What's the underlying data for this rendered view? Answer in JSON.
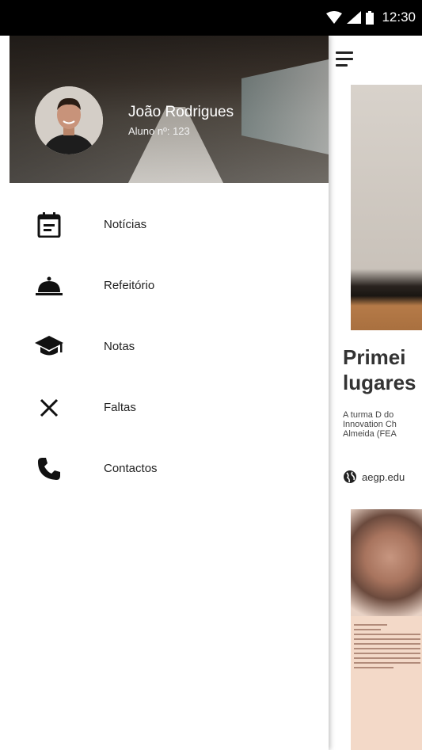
{
  "status_bar": {
    "time": "12:30"
  },
  "user": {
    "name": "João Rodrigues",
    "subtitle": "Aluno nº: 123"
  },
  "menu": {
    "items": [
      {
        "label": "Notícias",
        "icon": "calendar-news-icon"
      },
      {
        "label": "Refeitório",
        "icon": "cloche-icon"
      },
      {
        "label": "Notas",
        "icon": "graduation-cap-icon"
      },
      {
        "label": "Faltas",
        "icon": "close-icon"
      },
      {
        "label": "Contactos",
        "icon": "phone-icon"
      }
    ]
  },
  "background_feed": {
    "article_title_line1": "Primei",
    "article_title_line2": "lugares",
    "article_text_line1": "A turma D do",
    "article_text_line2": "Innovation Ch",
    "article_text_line3": "Almeida (FEA",
    "source": "aegp.edu"
  }
}
